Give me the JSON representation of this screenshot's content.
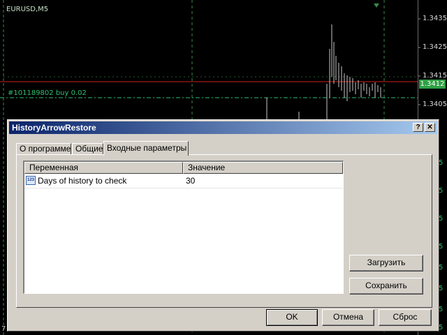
{
  "chart": {
    "symbol_label": "EURUSD,M5",
    "order_label": "#101189802 buy 0.02",
    "current_price": "1.3412",
    "price_labels": [
      "1.3435",
      "1.3425",
      "1.3415",
      "1.3405"
    ],
    "right_fragments": [
      "5",
      "5",
      "5",
      "5",
      "5",
      "5",
      "5",
      "5"
    ],
    "bottom_left_fragment": "7",
    "colors": {
      "background": "#000000",
      "order_line": "#2ec06e",
      "price_line": "#d02020",
      "candles": "#c8c8c8"
    }
  },
  "dialog": {
    "title": "HistoryArrowRestore",
    "help_button": "?",
    "close_button": "✕",
    "tabs": [
      {
        "label": "О программе",
        "active": false
      },
      {
        "label": "Общие",
        "active": false
      },
      {
        "label": "Входные параметры",
        "active": true
      }
    ],
    "table": {
      "headers": [
        "Переменная",
        "Значение"
      ],
      "rows": [
        {
          "icon": "integer-param-icon",
          "icon_text": "123",
          "name": "Days of history to check",
          "value": "30"
        }
      ]
    },
    "side_buttons": {
      "load": "Загрузить",
      "save": "Сохранить"
    },
    "footer_buttons": {
      "ok": "OK",
      "cancel": "Отмена",
      "reset": "Сброс"
    }
  }
}
